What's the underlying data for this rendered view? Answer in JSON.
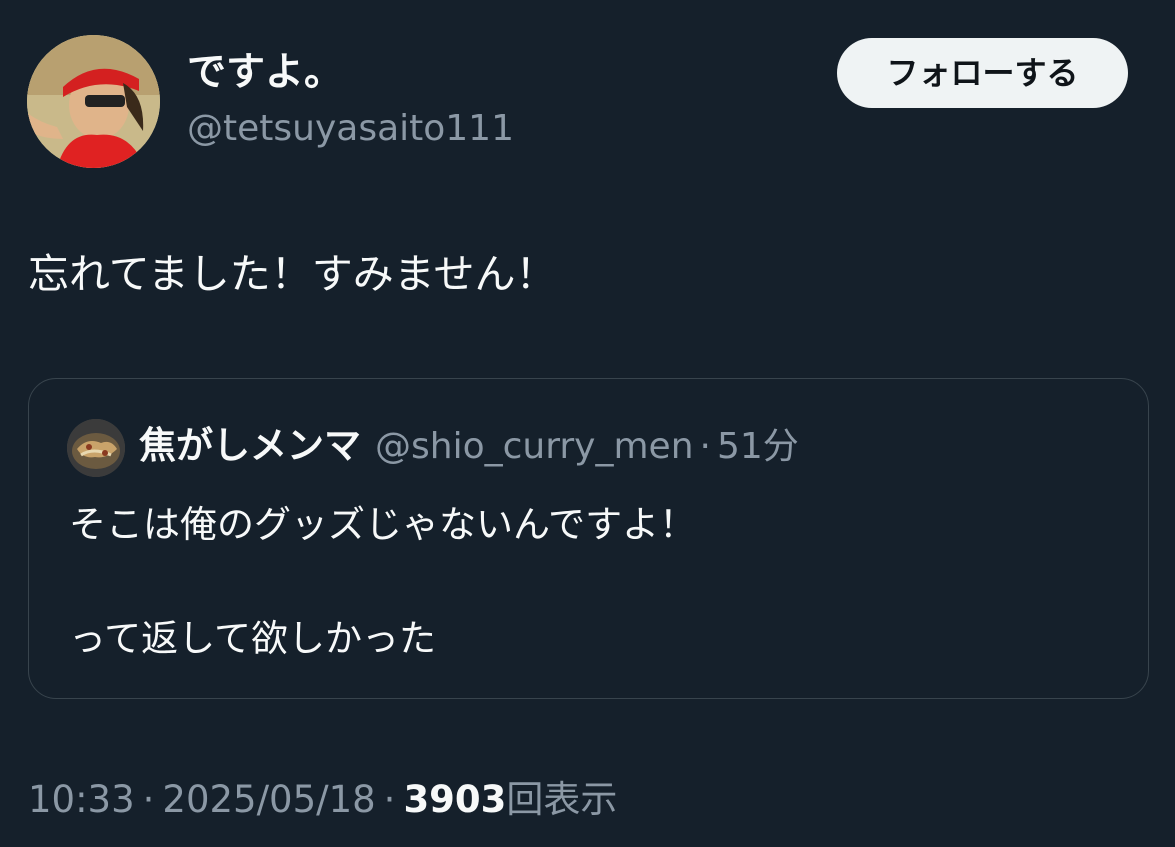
{
  "author": {
    "display_name": "ですよ。",
    "handle": "@tetsuyasaito111"
  },
  "follow_button": {
    "label": "フォローする"
  },
  "tweet": {
    "text": "忘れてました！すみません！"
  },
  "quoted_tweet": {
    "display_name": "焦がしメンマ",
    "handle": "@shio_curry_men",
    "separator": "·",
    "time": "51分",
    "line1": "そこは俺のグッズじゃないんですよ！",
    "line2": "って返して欲しかった"
  },
  "meta": {
    "time": "10:33",
    "separator": "·",
    "date": "2025/05/18",
    "views_count": "3903",
    "views_label": "回表示"
  },
  "colors": {
    "background": "#15202b",
    "text_primary": "#f7f9f9",
    "text_secondary": "#8b98a5",
    "border": "#38444d",
    "button_bg": "#eff3f4"
  }
}
